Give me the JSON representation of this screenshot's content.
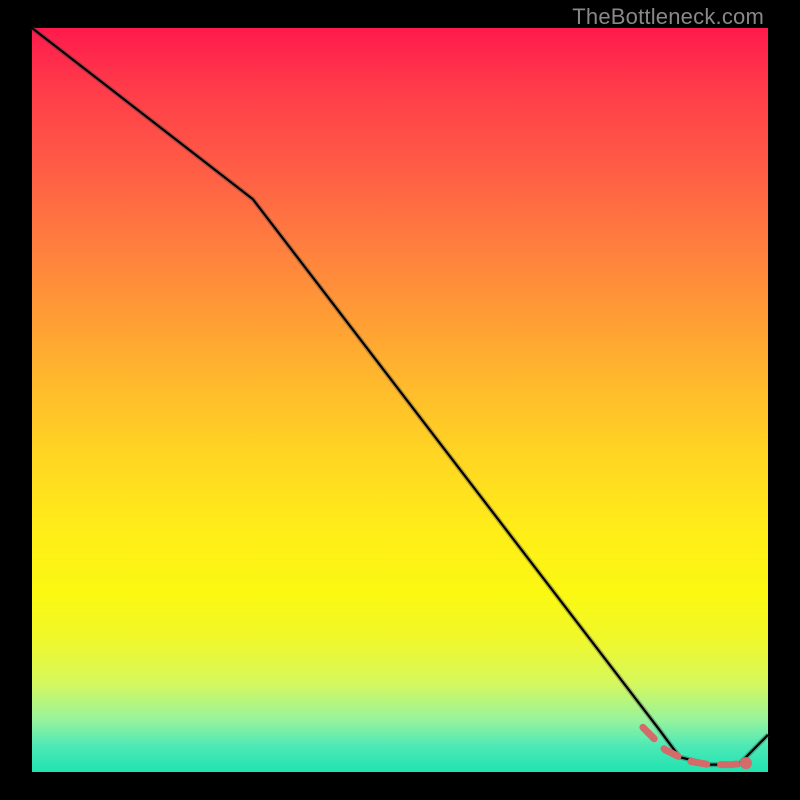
{
  "watermark": "TheBottleneck.com",
  "chart_data": {
    "type": "line",
    "title": "",
    "xlabel": "",
    "ylabel": "",
    "xlim": [
      0,
      100
    ],
    "ylim": [
      0,
      100
    ],
    "grid": false,
    "series": [
      {
        "name": "bottleneck-curve",
        "x": [
          0,
          30,
          85,
          88,
          92,
          96,
          100
        ],
        "values": [
          100,
          77,
          6,
          2,
          1,
          1,
          5
        ]
      },
      {
        "name": "highlighted-range-dashed",
        "x": [
          83,
          86,
          89,
          92,
          95,
          97
        ],
        "values": [
          6,
          3,
          1.5,
          1,
          1,
          1.2
        ]
      }
    ],
    "annotations": [
      {
        "type": "point",
        "name": "end-dot",
        "x": 97,
        "y": 1.2
      }
    ],
    "background_gradient": {
      "top": "#ff1a4d",
      "bottom": "#1fe3b0"
    }
  }
}
